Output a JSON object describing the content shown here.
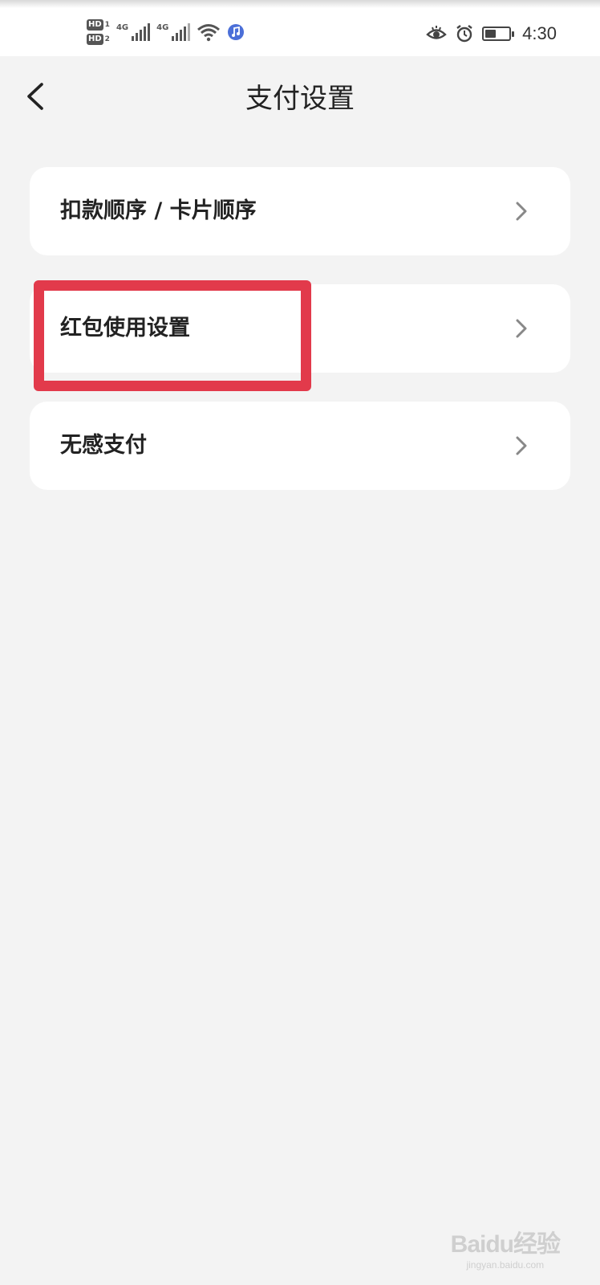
{
  "status_bar": {
    "sim1_label": "HD",
    "sim1_index": "1",
    "sim2_label": "HD",
    "sim2_index": "2",
    "net1": "4G",
    "net2": "4G",
    "time": "4:30",
    "battery_level": 0.45,
    "icons": [
      "signal-icon",
      "wifi-icon",
      "music-app-icon",
      "eye-icon",
      "alarm-icon",
      "battery-icon"
    ]
  },
  "nav": {
    "title": "支付设置",
    "back_icon": "chevron-left-icon"
  },
  "menu": {
    "items": [
      {
        "label": "扣款顺序 / 卡片顺序"
      },
      {
        "label": "红包使用设置"
      },
      {
        "label": "无感支付"
      }
    ]
  },
  "highlight": {
    "color": "#e23a4b"
  },
  "watermark": {
    "logo": "Baidu经验",
    "url": "jingyan.baidu.com"
  }
}
